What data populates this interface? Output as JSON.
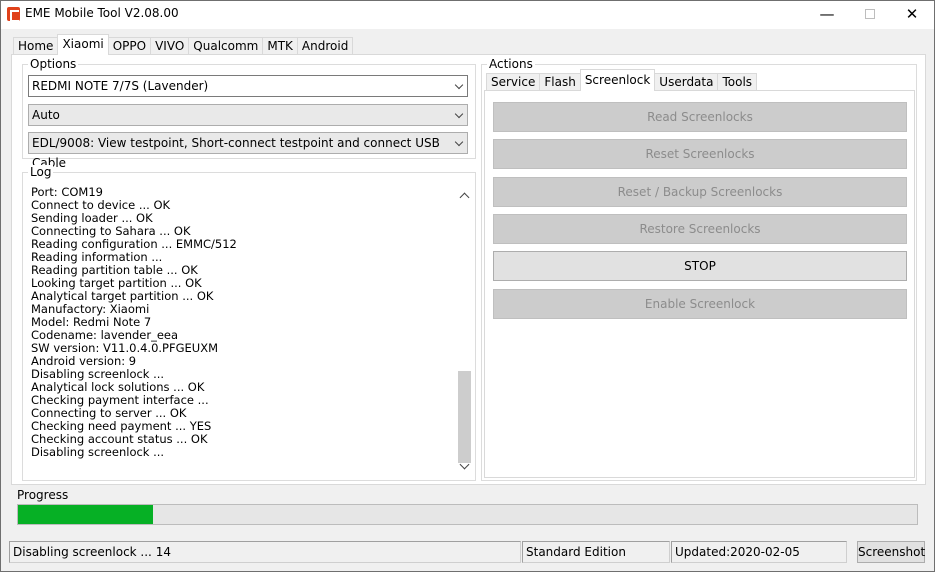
{
  "window": {
    "title": "EME Mobile Tool V2.08.00"
  },
  "top_tabs": [
    "Home",
    "Xiaomi",
    "OPPO",
    "VIVO",
    "Qualcomm",
    "MTK",
    "Android"
  ],
  "top_tabs_active": "Xiaomi",
  "options": {
    "label": "Options",
    "device": "REDMI NOTE 7/7S (Lavender)",
    "mode": "Auto",
    "connection": "EDL/9008: View testpoint, Short-connect testpoint and connect USB Cable"
  },
  "log": {
    "label": "Log",
    "lines": [
      "Port: COM19",
      "Connect to device ... OK",
      "Sending loader ... OK",
      "Connecting to Sahara ... OK",
      "Reading configuration ... EMMC/512",
      "Reading information ...",
      "Reading partition table ... OK",
      "Looking target partition ... OK",
      "Analytical target partition ... OK",
      "Manufactory: Xiaomi",
      "Model: Redmi Note 7",
      "Codename: lavender_eea",
      "SW version: V11.0.4.0.PFGEUXM",
      "Android version: 9",
      "Disabling screenlock ...",
      "Analytical lock solutions ... OK",
      "Checking payment interface ...",
      "Connecting to server ... OK",
      "Checking need payment ... YES",
      "Checking account status ... OK",
      "Disabling screenlock ..."
    ]
  },
  "actions": {
    "label": "Actions",
    "tabs": [
      "Service",
      "Flash",
      "Screenlock",
      "Userdata",
      "Tools"
    ],
    "active_tab": "Screenlock",
    "buttons": [
      {
        "label": "Read Screenlocks",
        "enabled": false
      },
      {
        "label": "Reset Screenlocks",
        "enabled": false
      },
      {
        "label": "Reset / Backup Screenlocks",
        "enabled": false
      },
      {
        "label": "Restore Screenlocks",
        "enabled": false
      },
      {
        "label": "STOP",
        "enabled": true
      },
      {
        "label": "Enable Screenlock",
        "enabled": false
      }
    ]
  },
  "progress": {
    "label": "Progress",
    "value_percent": 15,
    "color": "#06b025"
  },
  "status": {
    "message": "Disabling screenlock ... 14",
    "edition": "Standard Edition",
    "updated": "Updated:2020-02-05",
    "screenshot_button": "Screenshot"
  }
}
